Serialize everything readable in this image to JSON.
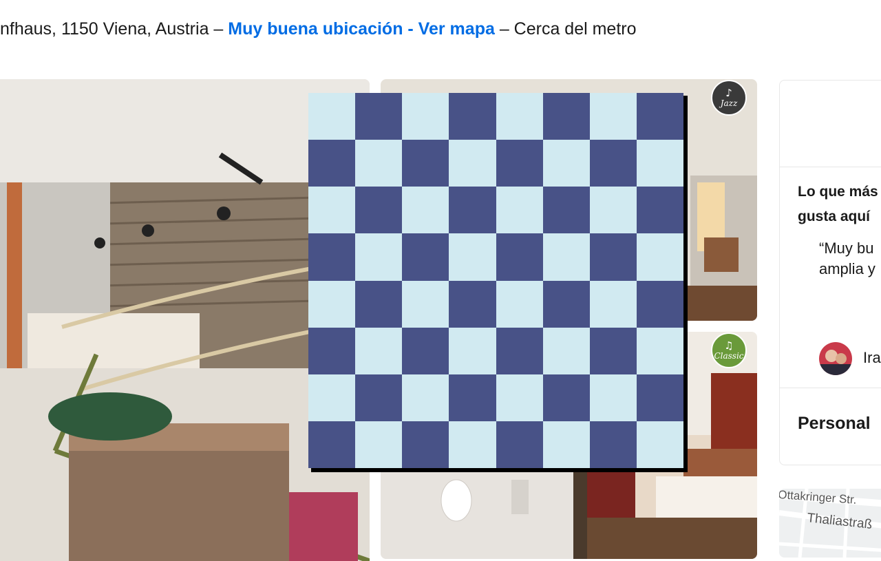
{
  "address": {
    "text_before": "nfhaus, 1150 Viena, Austria – ",
    "map_link": "Muy buena ubicación - Ver mapa",
    "text_after": " – Cerca del metro"
  },
  "badges": {
    "jazz": "Jazz",
    "classic": "Classic"
  },
  "chessboard": {
    "rows": 8,
    "cols": 8,
    "light_color": "#d1eaf1",
    "dark_color": "#485287"
  },
  "highlights": {
    "title": "Lo que más gusta aquí",
    "quote": "“Muy bu\namplia y",
    "reviewer": "Ira"
  },
  "staff_section": {
    "title": "Personal"
  },
  "map": {
    "street_1": "Ottakringer Str.",
    "street_2": "Thaliastraß"
  },
  "colors": {
    "link": "#006ce4",
    "border": "#e7e7e7"
  }
}
